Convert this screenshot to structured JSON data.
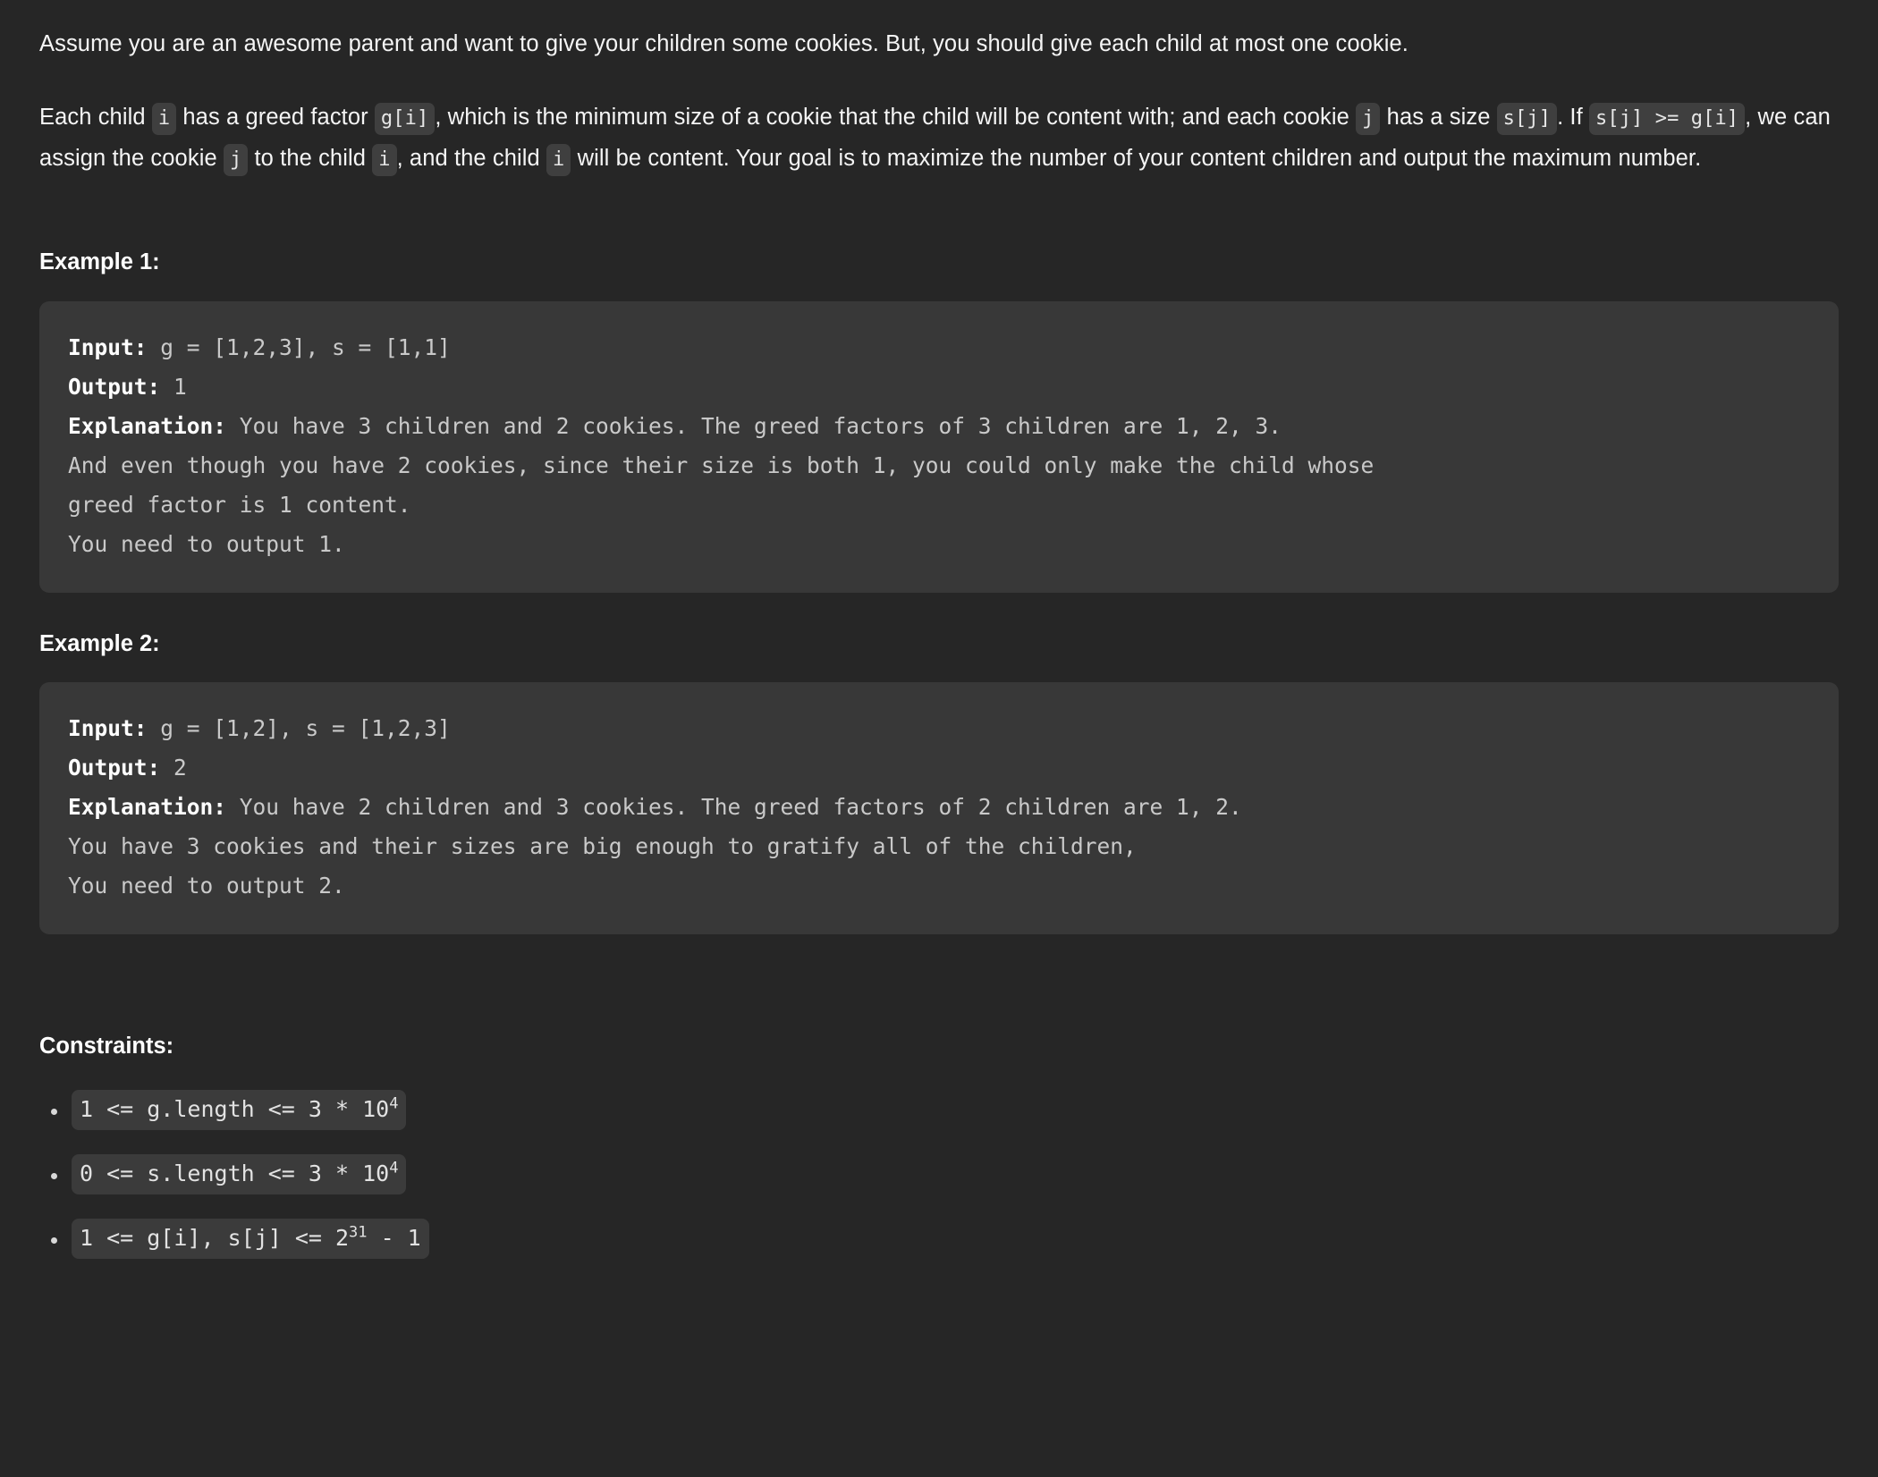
{
  "theme": {
    "page_bg": "#262626",
    "code_bg": "#383838",
    "chip_bg": "#3f3f3f",
    "text": "#f5f5f5",
    "code_text": "#c9c9c9",
    "label_text": "#ffffff"
  },
  "description": {
    "paragraph1": "Assume you are an awesome parent and want to give your children some cookies. But, you should give each child at most one cookie.",
    "paragraph2": {
      "seg1": "Each child ",
      "code1": "i",
      "seg2": " has a greed factor ",
      "code2": "g[i]",
      "seg3": ", which is the minimum size of a cookie that the child will be content with; and each cookie ",
      "code3": "j",
      "seg4": " has a size ",
      "code4": "s[j]",
      "seg5": ". If ",
      "code5": "s[j] >= g[i]",
      "seg6": ", we can assign the cookie ",
      "code6": "j",
      "seg7": " to the child ",
      "code7": "i",
      "seg8": ", and the child ",
      "code8": "i",
      "seg9": " will be content. Your goal is to maximize the number of your content children and output the maximum number."
    }
  },
  "examples": [
    {
      "heading": "Example 1:",
      "input_label": "Input:",
      "input_value": " g = [1,2,3], s = [1,1]",
      "output_label": "Output:",
      "output_value": " 1",
      "explanation_label": "Explanation:",
      "explanation_value": " You have 3 children and 2 cookies. The greed factors of 3 children are 1, 2, 3.\nAnd even though you have 2 cookies, since their size is both 1, you could only make the child whose\ngreed factor is 1 content.\nYou need to output 1."
    },
    {
      "heading": "Example 2:",
      "input_label": "Input:",
      "input_value": " g = [1,2], s = [1,2,3]",
      "output_label": "Output:",
      "output_value": " 2",
      "explanation_label": "Explanation:",
      "explanation_value": " You have 2 children and 3 cookies. The greed factors of 2 children are 1, 2.\nYou have 3 cookies and their sizes are big enough to gratify all of the children,\nYou need to output 2."
    }
  ],
  "constraints": {
    "heading": "Constraints:",
    "items": [
      {
        "base": "1 <= g.length <= 3 * 10",
        "sup": "4",
        "tail": ""
      },
      {
        "base": "0 <= s.length <= 3 * 10",
        "sup": "4",
        "tail": ""
      },
      {
        "base": "1 <= g[i], s[j] <= 2",
        "sup": "31",
        "tail": " - 1"
      }
    ]
  }
}
